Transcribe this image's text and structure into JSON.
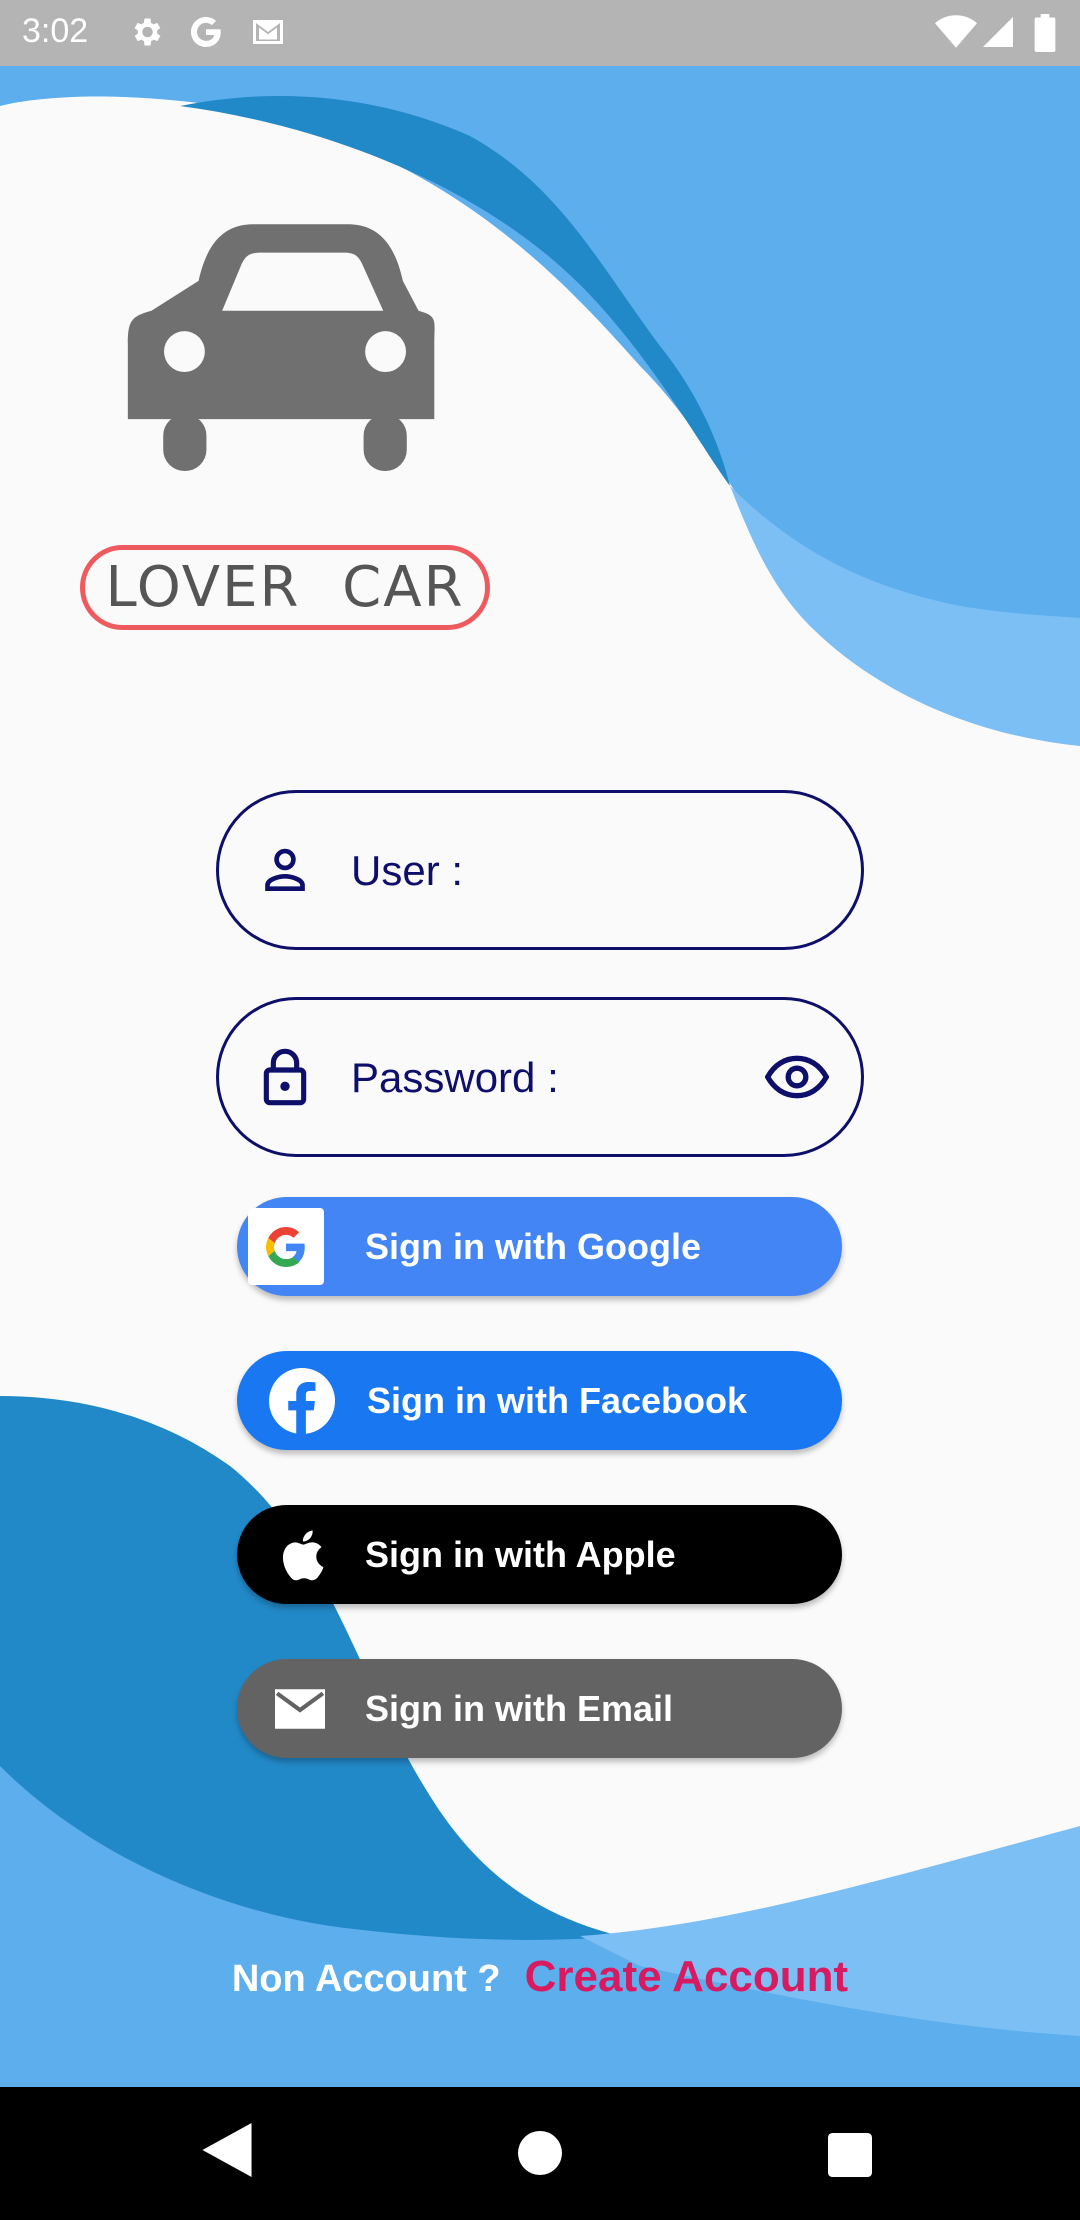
{
  "status_bar": {
    "time": "3:02",
    "icons": [
      "settings-icon",
      "google-icon",
      "gmail-icon",
      "wifi-icon",
      "signal-icon",
      "battery-icon"
    ]
  },
  "logo": {
    "text": "LOVER CAR",
    "icon": "car-icon",
    "border_color": "#ef5a5e"
  },
  "form": {
    "user_placeholder": "User :",
    "password_placeholder": "Password :",
    "user_icon": "person-icon",
    "password_icon": "lock-icon",
    "visibility_icon": "eye-icon",
    "accent_color": "#0d0f6b"
  },
  "buttons": {
    "google": {
      "label": "Sign in with Google",
      "icon": "google-logo-icon",
      "color": "#4385f4"
    },
    "facebook": {
      "label": "Sign in with Facebook",
      "icon": "facebook-icon",
      "color": "#1977f2"
    },
    "apple": {
      "label": "Sign in with Apple",
      "icon": "apple-icon",
      "color": "#000000"
    },
    "email": {
      "label": "Sign in with Email",
      "icon": "mail-icon",
      "color": "#636363"
    }
  },
  "footer": {
    "prompt": "Non Account ?",
    "link": "Create Account",
    "link_color": "#d81b60"
  },
  "nav_bar": {
    "icons": [
      "back-icon",
      "home-icon",
      "recents-icon"
    ]
  },
  "colors": {
    "wave_light": "#5caeed",
    "wave_dark": "#2289c8",
    "wave_lighter": "#7cbff5",
    "background": "#fafafa"
  }
}
